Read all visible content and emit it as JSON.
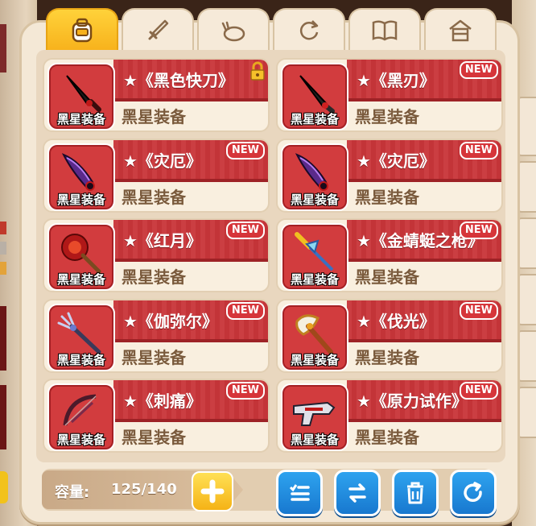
{
  "tabs": [
    {
      "name": "backpack",
      "icon": "backpack-icon",
      "active": true
    },
    {
      "name": "weapon",
      "icon": "sword-icon",
      "active": false
    },
    {
      "name": "food",
      "icon": "food-icon",
      "active": false
    },
    {
      "name": "refresh",
      "icon": "cycle-icon",
      "active": false
    },
    {
      "name": "book",
      "icon": "book-icon",
      "active": false
    },
    {
      "name": "house",
      "icon": "house-icon",
      "active": false
    }
  ],
  "items": [
    {
      "name": "★《黑色快刀》",
      "sub": "黑星装备",
      "icon_label": "黑星装备",
      "badge": "",
      "locked": true,
      "weapon": "black-knife-icon"
    },
    {
      "name": "★《黑刃》",
      "sub": "黑星装备",
      "icon_label": "黑星装备",
      "badge": "NEW",
      "locked": false,
      "weapon": "black-blade-icon"
    },
    {
      "name": "★《灾厄》",
      "sub": "黑星装备",
      "icon_label": "黑星装备",
      "badge": "NEW",
      "locked": false,
      "weapon": "purple-blade-icon"
    },
    {
      "name": "★《灾厄》",
      "sub": "黑星装备",
      "icon_label": "黑星装备",
      "badge": "NEW",
      "locked": false,
      "weapon": "purple-blade-icon"
    },
    {
      "name": "★《红月》",
      "sub": "黑星装备",
      "icon_label": "黑星装备",
      "badge": "NEW",
      "locked": false,
      "weapon": "red-moon-staff-icon"
    },
    {
      "name": "★《金蜻蜓之枪》",
      "sub": "黑星装备",
      "icon_label": "黑星装备",
      "badge": "NEW",
      "locked": false,
      "weapon": "golden-spear-icon"
    },
    {
      "name": "★《伽弥尔》",
      "sub": "黑星装备",
      "icon_label": "黑星装备",
      "badge": "NEW",
      "locked": false,
      "weapon": "trident-icon"
    },
    {
      "name": "★《伐光》",
      "sub": "黑星装备",
      "icon_label": "黑星装备",
      "badge": "NEW",
      "locked": false,
      "weapon": "axe-icon"
    },
    {
      "name": "★《刺痛》",
      "sub": "黑星装备",
      "icon_label": "黑星装备",
      "badge": "NEW",
      "locked": false,
      "weapon": "bow-icon"
    },
    {
      "name": "★《原力试作》",
      "sub": "黑星装备",
      "icon_label": "黑星装备",
      "badge": "NEW",
      "locked": false,
      "weapon": "gun-icon"
    }
  ],
  "capacity": {
    "label": "容量:",
    "value": "125/140"
  },
  "actions": [
    {
      "name": "sort-list",
      "icon": "list-icon"
    },
    {
      "name": "swap",
      "icon": "swap-icon"
    },
    {
      "name": "delete",
      "icon": "trash-icon"
    },
    {
      "name": "refresh",
      "icon": "refresh-icon"
    }
  ],
  "colors": {
    "ribbon": "#c9363a",
    "tab_active": "#ffd23a",
    "button_blue": "#1f8ce0"
  }
}
